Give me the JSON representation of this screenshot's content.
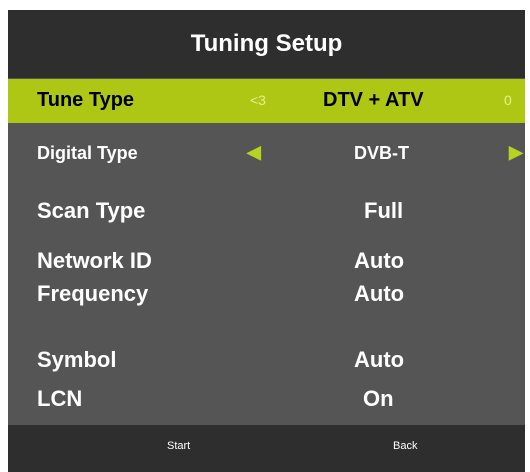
{
  "title": "Tuning Setup",
  "rows": [
    {
      "label": "Tune Type",
      "value": "DTV + ATV",
      "hint_left": "<3",
      "hint_right": "0"
    },
    {
      "label": "Digital Type",
      "value": "DVB-T",
      "arrow_left": "◀",
      "arrow_right": "▶"
    },
    {
      "label": "Scan Type",
      "value": "Full"
    },
    {
      "label": "Network ID",
      "value": "Auto"
    },
    {
      "label": "Frequency",
      "value": "Auto"
    },
    {
      "label": "Symbol",
      "value": "Auto"
    },
    {
      "label": "LCN",
      "value": "On"
    }
  ],
  "footer": {
    "start": "Start",
    "back": "Back"
  },
  "colors": {
    "highlight": "#aec614",
    "panel": "#555555",
    "bar": "#2e2e2e",
    "arrow": "#b6d321"
  }
}
